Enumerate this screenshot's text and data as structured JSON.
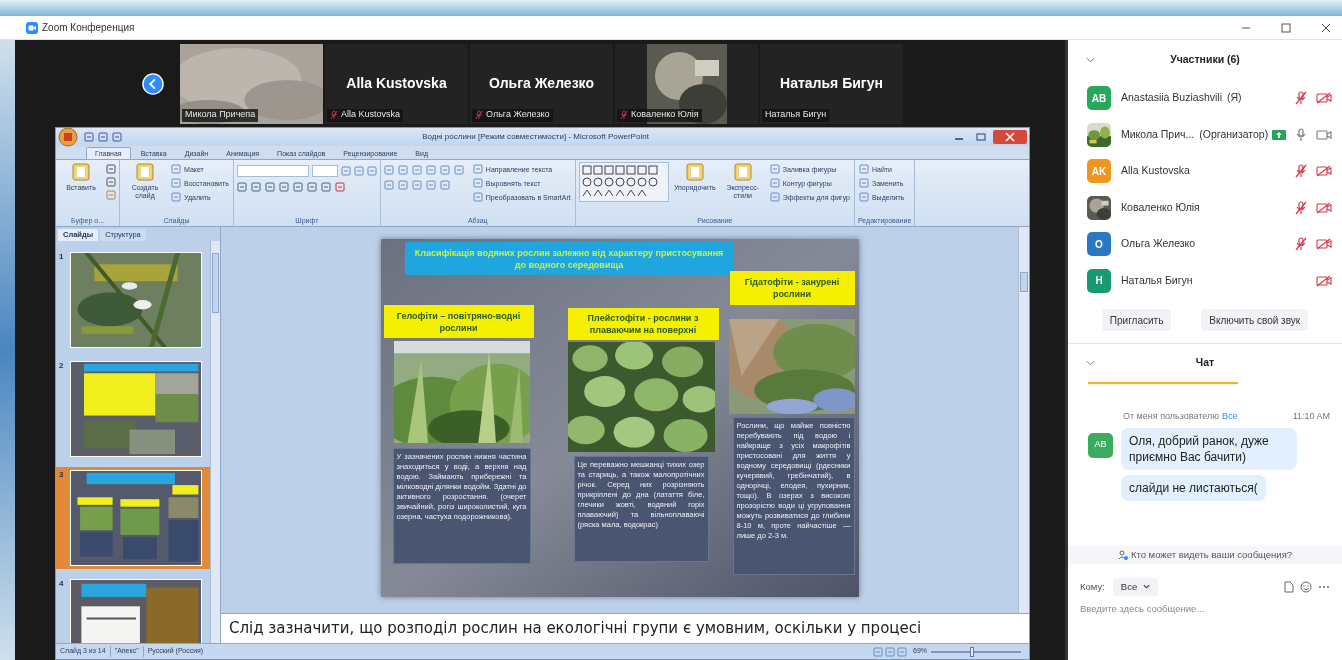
{
  "zoom_window": {
    "title": "Zoom Конференция"
  },
  "video_strip": {
    "tiles": [
      {
        "kind": "picture",
        "name": "Микола Причепа",
        "muted": false
      },
      {
        "kind": "name",
        "display_name": "Alla Kustovska",
        "name": "Alla Kustovska",
        "muted": true
      },
      {
        "kind": "name",
        "display_name": "Ольга Железко",
        "name": "Ольга Железко",
        "muted": true
      },
      {
        "kind": "picture",
        "name": "Коваленко Юлія",
        "muted": true
      },
      {
        "kind": "name",
        "display_name": "Наталья Бигун",
        "name": "Наталья Бигун",
        "muted": false
      }
    ]
  },
  "powerpoint": {
    "title": "Водні рослини [Режим совместимости] - Microsoft PowerPoint",
    "tabs": [
      {
        "label": "Главная",
        "selected": true
      },
      {
        "label": "Вставка",
        "selected": false
      },
      {
        "label": "Дизайн",
        "selected": false
      },
      {
        "label": "Анимация",
        "selected": false
      },
      {
        "label": "Показ слайдов",
        "selected": false
      },
      {
        "label": "Рецензирование",
        "selected": false
      },
      {
        "label": "Вид",
        "selected": false
      }
    ],
    "ribbon_groups": [
      {
        "kind": "clipboard",
        "label": "Буфер о...",
        "items": [
          "Вставить"
        ]
      },
      {
        "kind": "slides",
        "label": "Слайды",
        "items": [
          "Создать слайд",
          "Макет",
          "Восстановить",
          "Удалить"
        ]
      },
      {
        "kind": "font",
        "label": "Шрифт"
      },
      {
        "kind": "paragraph",
        "label": "Абзац",
        "items": [
          "Направление текста",
          "Выровнять текст",
          "Преобразовать в SmartArt"
        ]
      },
      {
        "kind": "drawing",
        "label": "Рисование",
        "items": [
          "Упорядочить",
          "Экспресс-стили",
          "Заливка фигуры",
          "Контур фигуры",
          "Эффекты для фигур"
        ]
      },
      {
        "kind": "editing",
        "label": "Редактирование",
        "items": [
          "Найти",
          "Заменить",
          "Выделить"
        ]
      }
    ],
    "pane_tabs": [
      {
        "label": "Слайды",
        "selected": true
      },
      {
        "label": "Структура",
        "selected": false
      }
    ],
    "thumbnails": [
      {
        "number": "1",
        "selected": false
      },
      {
        "number": "2",
        "selected": false
      },
      {
        "number": "3",
        "selected": true
      },
      {
        "number": "4",
        "selected": false
      }
    ],
    "slide": {
      "title": "Класифікація водяних рослин залежно від характеру пристосування до водного середовища",
      "columns": [
        {
          "heading": "Гелофіти – повітряно-водні рослини",
          "text": "У зазначених рослин нижня частина знаходиться у воді, а верхня над водою. Займають прибережні та мілководні ділянки водойм. Здатні до активного розростання. (очерет звичайний, рогіз широколистий, куга озерна, частуха подорожникова)."
        },
        {
          "heading": "Плейстофіти - рослини з плаваючим на поверхні",
          "text": "Це переважно мешканці тихих озер та стариць, а також малопротічних річок. Серед них розрізняють прикріплені до дна (латаття біле, глечики жовті, водяний горіх плаваючий) та вільноплаваючі (ряска мала, водокрас)"
        },
        {
          "heading": "Гідатофіти - занурені рослини",
          "text": "Рослини, що майже повністю перебувають під водою і найкраще з усіх макрофітів пристосовані для життя у водному середовищі (рдесники кучерявий, гребінчатий), в однорічці, елодея, пухирник, тощо). В озерах з високою прозорістю води ці угруповання можуть розвиватися до глибини 8-10 м, проте найчастіше — лише до 2-3 м."
        }
      ]
    },
    "notes": "Слід зазначити, що розподіл рослин на екологічні групи є умовним, оскільки у процесі",
    "status_bar": {
      "slide": "Слайд 3 из 14",
      "theme": "\"Апекс\"",
      "language": "Русский (Россия)",
      "zoom": "69%",
      "zoom_slider": {
        "level": 0.45
      }
    }
  },
  "participants_panel": {
    "title": "Участники (6)",
    "participants": [
      {
        "avatar": {
          "kind": "initials",
          "text": "AB",
          "color": "#27a85a"
        },
        "name": "Anastasiia Buziashvili",
        "suffix": "(Я)",
        "sharing": false,
        "mic_hidden": false,
        "mic_muted": true,
        "video_off": true
      },
      {
        "name": "Микола Прич...",
        "suffix": "(Организатор)",
        "sharing": true,
        "mic_hidden": false,
        "mic_muted": false,
        "video_off": false
      },
      {
        "avatar": {
          "kind": "initials",
          "text": "AK",
          "color": "#f0961c"
        },
        "name": "Alla Kustovska",
        "sharing": false,
        "mic_hidden": false,
        "mic_muted": true,
        "video_off": true
      },
      {
        "name": "Коваленко Юлія",
        "sharing": false,
        "mic_hidden": false,
        "mic_muted": true,
        "video_off": true
      },
      {
        "avatar": {
          "kind": "initials",
          "text": "O",
          "color": "#2a78c2"
        },
        "name": "Ольга Железко",
        "sharing": false,
        "mic_hidden": false,
        "mic_muted": true,
        "video_off": true
      },
      {
        "avatar": {
          "kind": "initials",
          "text": "H",
          "color": "#179a72"
        },
        "name": "Наталья Бигун",
        "sharing": false,
        "mic_hidden": true,
        "video_off": true
      }
    ],
    "buttons": [
      "Пригласить",
      "Включить свой звук"
    ]
  },
  "chat": {
    "title": "Чат",
    "message": {
      "prefix": "От меня пользователю",
      "recipient": "Все",
      "time": "11:10 AM",
      "avatar": "AB",
      "color": "#3aad5c",
      "bubbles": [
        "Оля, добрий ранок, дуже приємно Вас бачити)",
        "слайди не листаються("
      ]
    },
    "privacy_note": "Кто может видеть ваши сообщения?",
    "to_label": "Кому:",
    "to_value": "Все",
    "placeholder": "Введите здесь сообщение..."
  }
}
